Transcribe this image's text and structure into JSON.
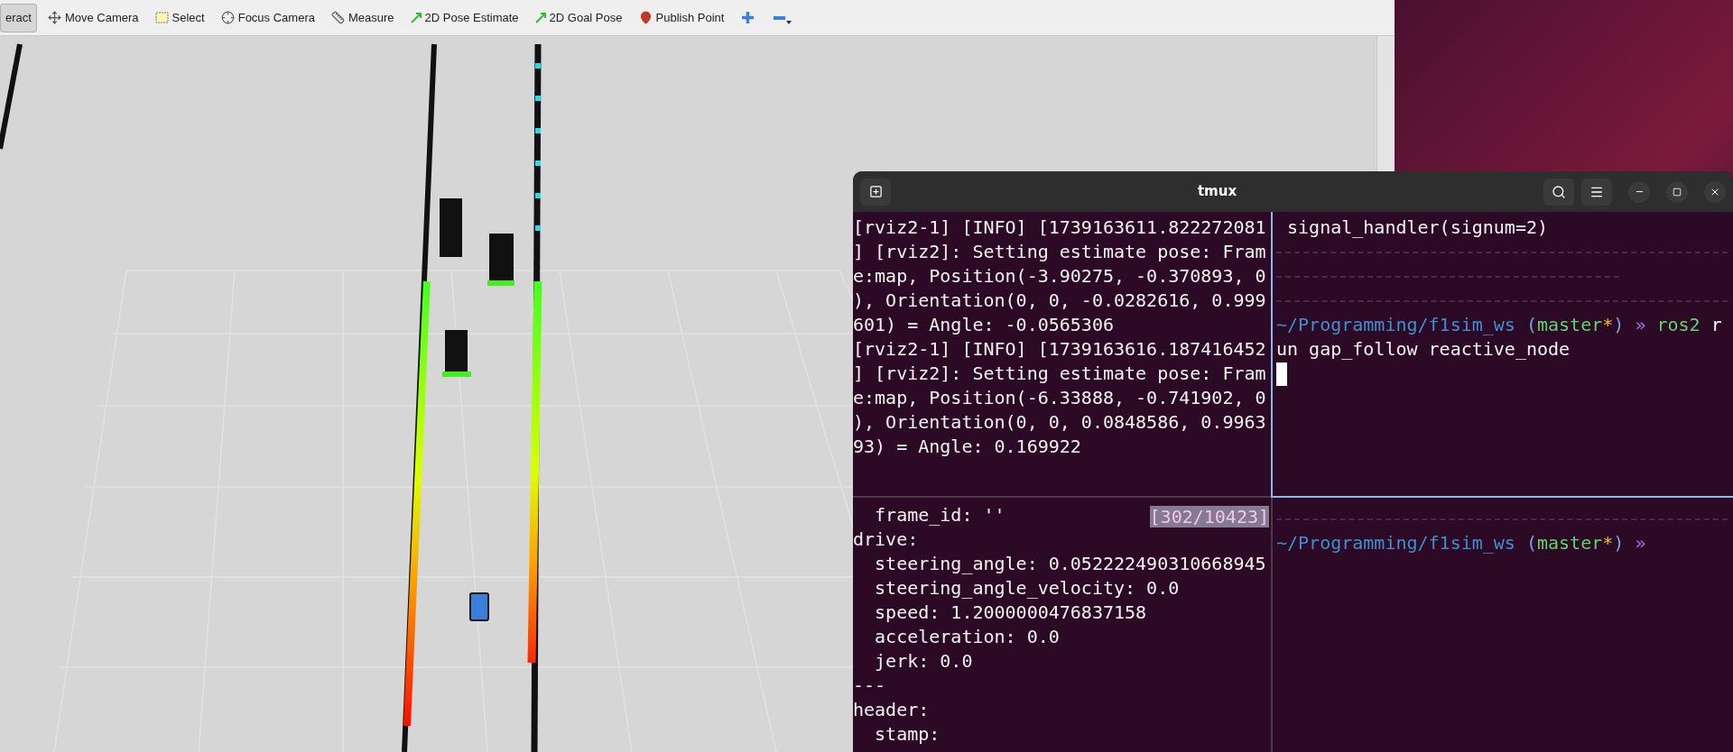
{
  "toolbar": {
    "tools": [
      {
        "label": "eract",
        "kind": "plain",
        "selected": true
      },
      {
        "label": "Move Camera",
        "kind": "move",
        "selected": false
      },
      {
        "label": "Select",
        "kind": "select",
        "selected": false
      },
      {
        "label": "Focus Camera",
        "kind": "focus",
        "selected": false
      },
      {
        "label": "Measure",
        "kind": "measure",
        "selected": false
      },
      {
        "label": "2D Pose Estimate",
        "kind": "pose",
        "selected": false
      },
      {
        "label": "2D Goal Pose",
        "kind": "pose",
        "selected": false
      },
      {
        "label": "Publish Point",
        "kind": "point",
        "selected": false
      }
    ]
  },
  "terminal": {
    "title": "tmux",
    "top_left": {
      "lines": [
        "[rviz2-1] [INFO] [1739163611.822272081",
        "] [rviz2]: Setting estimate pose: Fram",
        "e:map, Position(-3.90275, -0.370893, 0",
        "), Orientation(0, 0, -0.0282616, 0.999",
        "601) = Angle: -0.0565306",
        "[rviz2-1] [INFO] [1739163616.187416452",
        "] [rviz2]: Setting estimate pose: Fram",
        "e:map, Position(-6.33888, -0.741902, 0",
        "), Orientation(0, 0, 0.0848586, 0.9963",
        "93) = Angle: 0.169922"
      ]
    },
    "top_right": {
      "lines": [
        {
          "kind": "text",
          "text": " signal_handler(signum=2)"
        },
        {
          "kind": "rule"
        },
        {
          "kind": "halfrule"
        },
        {
          "kind": "rule"
        },
        {
          "kind": "prompt",
          "segments": [
            {
              "text": "~/Programming/f1sim_ws",
              "color": "#3f8fd0"
            },
            {
              "text": "(",
              "color": "#6fa8e0"
            },
            {
              "text": "master",
              "color": "#5fd36a"
            },
            {
              "text": "*",
              "color": "#e8c020"
            },
            {
              "text": ")",
              "color": "#6fa8e0"
            },
            {
              "text": "»",
              "color": "#9a6ee8"
            },
            {
              "text": "ros2",
              "color": "#5fd36a"
            },
            {
              "text": "r",
              "color": "#ffffff"
            }
          ]
        },
        {
          "kind": "text",
          "text": "un gap_follow reactive_node"
        },
        {
          "kind": "cursor"
        }
      ]
    },
    "bottom_left": {
      "badge": "[302/10423]",
      "lines": [
        "  frame_id: ''",
        "drive:",
        "  steering_angle: 0.052222490310668945",
        "  steering_angle_velocity: 0.0",
        "  speed: 1.2000000476837158",
        "  acceleration: 0.0",
        "  jerk: 0.0",
        "---",
        "header:",
        "  stamp:"
      ]
    },
    "bottom_right": {
      "lines": [
        {
          "kind": "rule"
        },
        {
          "kind": "prompt",
          "segments": [
            {
              "text": "~/Programming/f1sim_ws",
              "color": "#3f8fd0"
            },
            {
              "text": "(",
              "color": "#6fa8e0"
            },
            {
              "text": "master",
              "color": "#5fd36a"
            },
            {
              "text": "*",
              "color": "#e8c020"
            },
            {
              "text": ")",
              "color": "#6fa8e0"
            },
            {
              "text": "»",
              "color": "#9a6ee8"
            }
          ]
        }
      ]
    }
  }
}
